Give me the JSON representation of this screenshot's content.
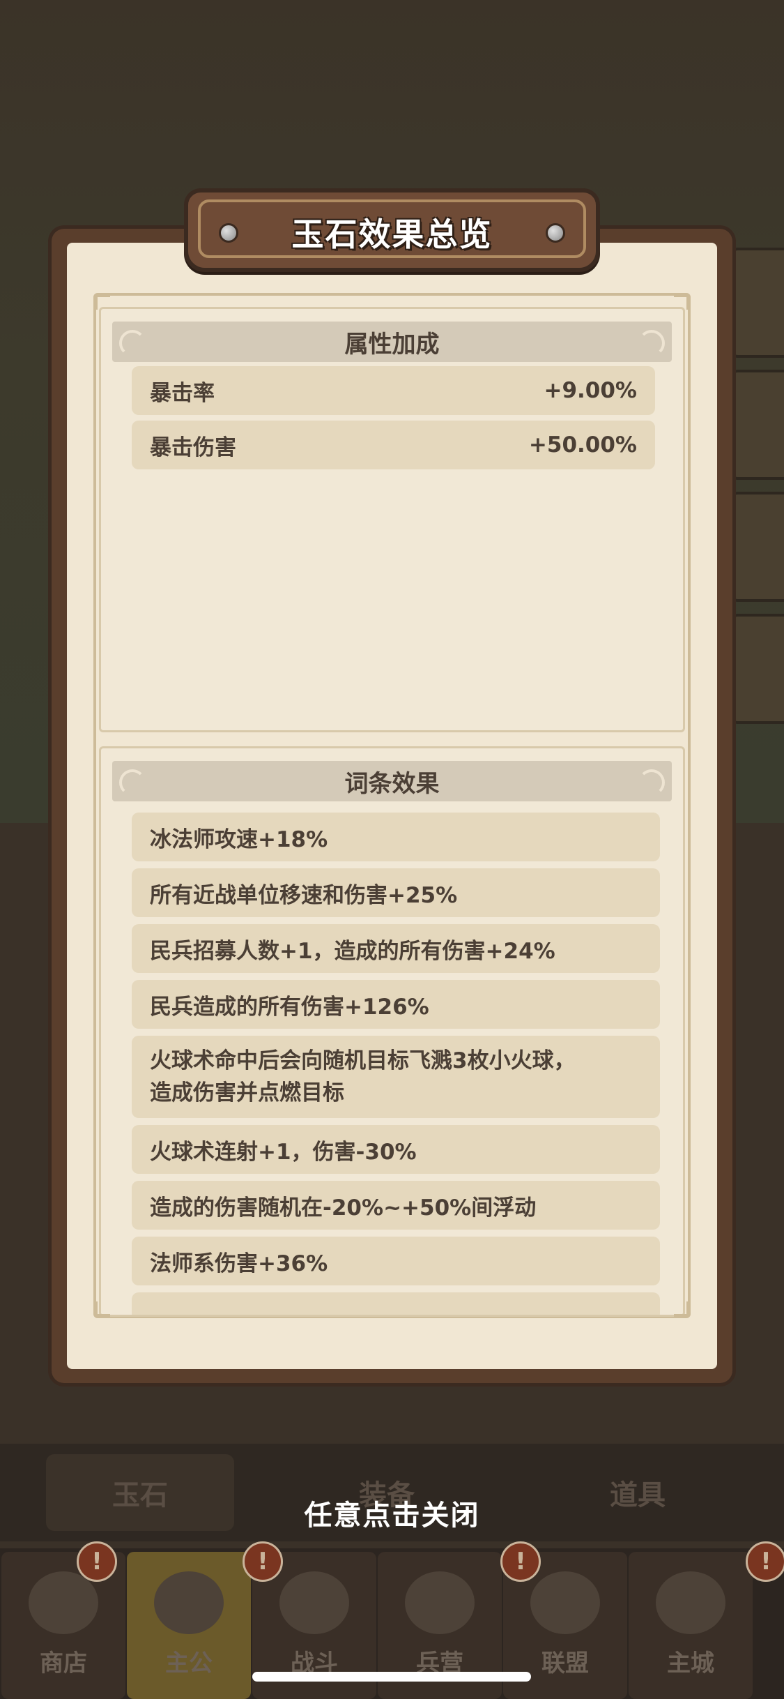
{
  "popup": {
    "title": "玉石效果总览",
    "attributes_section": {
      "header": "属性加成",
      "items": [
        {
          "name": "暴击率",
          "value": "+9.00%"
        },
        {
          "name": "暴击伤害",
          "value": "+50.00%"
        }
      ]
    },
    "affix_section": {
      "header": "词条效果",
      "items": [
        "冰法师攻速+18%",
        "所有近战单位移速和伤害+25%",
        "民兵招募人数+1，造成的所有伤害+24%",
        "民兵造成的所有伤害+126%",
        {
          "line1": "火球术命中后会向随机目标飞溅3枚小火球，",
          "line2": "造成伤害并点燃目标"
        },
        "火球术连射+1，伤害-30%",
        "造成的伤害随机在-20%~+50%间浮动",
        "法师系伤害+36%"
      ]
    },
    "close_hint": "任意点击关闭"
  },
  "background": {
    "sub_tabs": [
      "玉石",
      "装备",
      "道具"
    ],
    "nav": [
      {
        "label": "商店",
        "alert": "!"
      },
      {
        "label": "主公",
        "alert": "!"
      },
      {
        "label": "战斗",
        "alert": ""
      },
      {
        "label": "兵营",
        "alert": "!"
      },
      {
        "label": "联盟",
        "alert": ""
      },
      {
        "label": "主城",
        "alert": "!"
      }
    ]
  },
  "colors": {
    "panel_border": "#5a3e2c",
    "panel_fill": "#f1e7d3",
    "row_fill": "#e5d8bd",
    "header_fill": "#d4cab8",
    "text": "#4b3f35",
    "nav_active": "#6b5a2a"
  }
}
